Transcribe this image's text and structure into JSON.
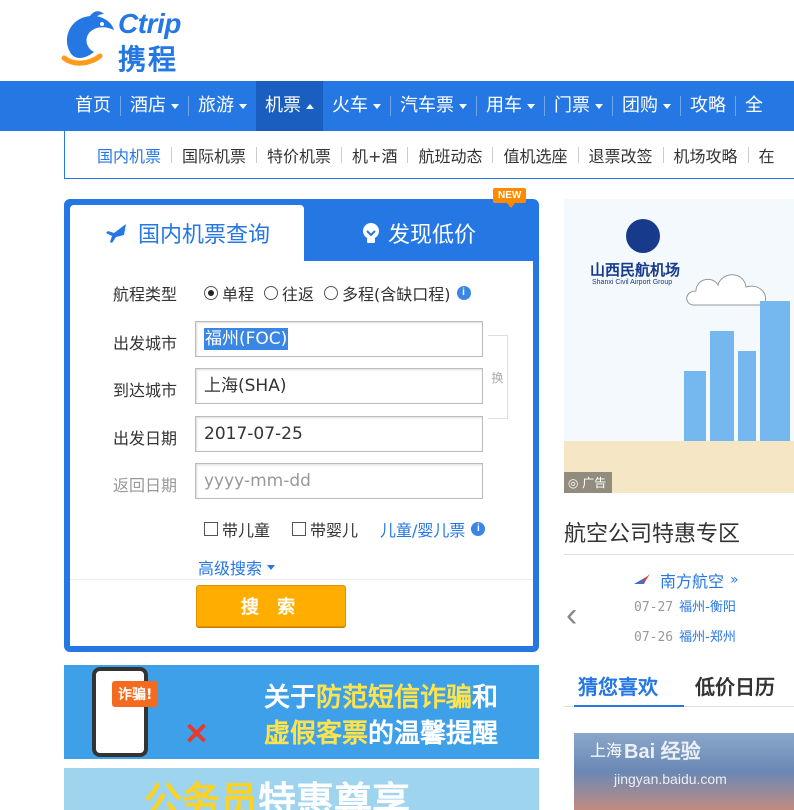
{
  "brand": {
    "name_en": "Ctrip",
    "name_cn": "携程",
    "color": "#2577e3"
  },
  "main_nav": [
    {
      "label": "首页",
      "dropdown": false
    },
    {
      "label": "酒店",
      "dropdown": true
    },
    {
      "label": "旅游",
      "dropdown": true
    },
    {
      "label": "机票",
      "dropdown": true,
      "active": true
    },
    {
      "label": "火车",
      "dropdown": true
    },
    {
      "label": "汽车票",
      "dropdown": true
    },
    {
      "label": "用车",
      "dropdown": true
    },
    {
      "label": "门票",
      "dropdown": true
    },
    {
      "label": "团购",
      "dropdown": true
    },
    {
      "label": "攻略",
      "dropdown": false
    },
    {
      "label": "全",
      "dropdown": false
    }
  ],
  "sub_nav": [
    "国内机票",
    "国际机票",
    "特价机票",
    "机+酒",
    "航班动态",
    "值机选座",
    "退票改签",
    "机场攻略",
    "在"
  ],
  "search_panel": {
    "tab_active": "国内机票查询",
    "tab_other": "发现低价",
    "new_badge": "NEW",
    "trip_type_label": "航程类型",
    "trip_options": [
      "单程",
      "往返",
      "多程(含缺口程)"
    ],
    "trip_selected": "单程",
    "depart_city_label": "出发城市",
    "depart_city": "福州(FOC)",
    "arrive_city_label": "到达城市",
    "arrive_city": "上海(SHA)",
    "swap_label": "换",
    "depart_date_label": "出发日期",
    "depart_date": "2017-07-25",
    "return_date_label": "返回日期",
    "return_date_placeholder": "yyyy-mm-dd",
    "child_label": "带儿童",
    "infant_label": "带婴儿",
    "child_infant_link": "儿童/婴儿票",
    "advanced_search": "高级搜索",
    "search_button": "搜 索"
  },
  "banner1": {
    "badge": "诈骗!",
    "line1_a": "关于",
    "line1_b": "防范短信诈骗",
    "line1_c": "和",
    "line2_a": "虚假客票",
    "line2_b": "的温馨提醒"
  },
  "banner2": {
    "text_a": "公务员",
    "text_b": "特惠尊享"
  },
  "ad": {
    "name": "山西民航机场",
    "name_en": "Shanxi Civil Airport Group",
    "ad_tag": "广告"
  },
  "airline_section": {
    "title": "航空公司特惠专区",
    "airline": "南方航空",
    "chevron": "»",
    "routes": [
      {
        "date": "07-27",
        "route": "福州-衡阳"
      },
      {
        "date": "07-26",
        "route": "福州-郑州"
      }
    ]
  },
  "tabs2": {
    "active": "猜您喜欢",
    "other": "低价日历"
  },
  "city_card": {
    "label": "上海",
    "watermark": "Bai 经验",
    "watermark_url": "jingyan.baidu.com"
  }
}
